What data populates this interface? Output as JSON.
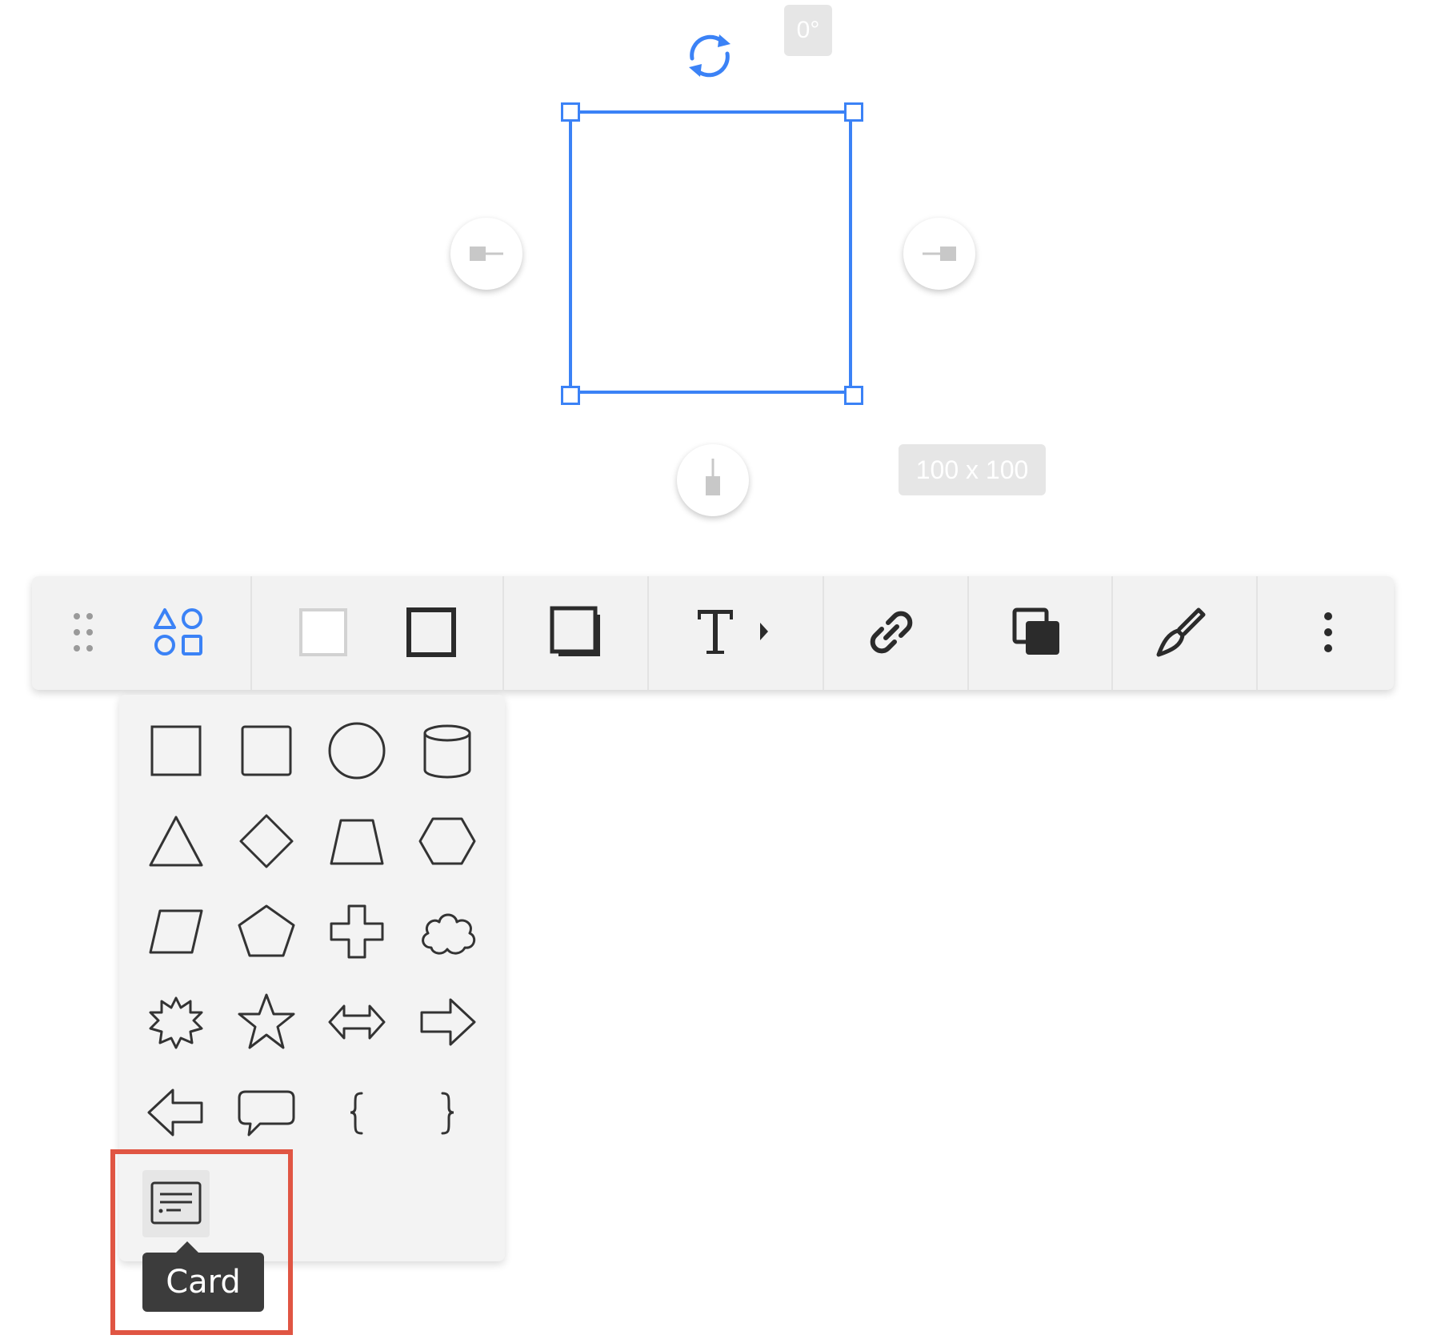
{
  "canvas": {
    "rotation_label": "0°",
    "size_label": "100 x 100",
    "selection_color": "#3b82f6"
  },
  "toolbar": {
    "items": [
      {
        "name": "drag-handle",
        "icon": "drag-dots-icon"
      },
      {
        "name": "shapes",
        "icon": "shapes-icon",
        "active": true
      },
      {
        "name": "fill-color",
        "icon": "fill-swatch-icon"
      },
      {
        "name": "border-style",
        "icon": "border-square-icon"
      },
      {
        "name": "shadow",
        "icon": "shadow-square-icon"
      },
      {
        "name": "text",
        "icon": "text-t-icon"
      },
      {
        "name": "link",
        "icon": "link-icon"
      },
      {
        "name": "layer-order",
        "icon": "layers-icon"
      },
      {
        "name": "style-brush",
        "icon": "brush-icon"
      },
      {
        "name": "more",
        "icon": "more-vertical-icon"
      }
    ],
    "accent_color": "#3b82f6"
  },
  "shapes_panel": {
    "shapes": [
      "square",
      "rounded-square",
      "circle",
      "cylinder",
      "triangle",
      "diamond",
      "trapezoid",
      "hexagon",
      "parallelogram",
      "pentagon",
      "cross",
      "cloud",
      "starburst",
      "star",
      "double-arrow",
      "arrow-right",
      "arrow-left",
      "speech-bubble",
      "brace-left",
      "brace-right",
      "card"
    ],
    "hovered": "card",
    "tooltip": "Card"
  },
  "highlight": {
    "color": "#e05543"
  }
}
